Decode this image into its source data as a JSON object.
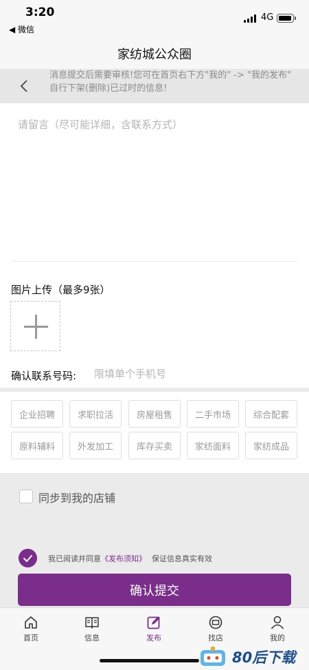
{
  "status": {
    "time": "3:20",
    "back_app": "◀ 微信",
    "network": "4G"
  },
  "nav": {
    "title": "家纺城公众圈"
  },
  "notice": {
    "text": "消息提交后需要审核!您可在首页右下方\"我的\" -> \"我的发布\" 自行下架(删除)已过时的信息!"
  },
  "form": {
    "message_placeholder": "请留言（尽可能详细，含联系方式）",
    "upload_label": "图片上传（最多9张）",
    "phone_label": "确认联系号码:",
    "phone_placeholder": "限填单个手机号"
  },
  "categories": [
    "企业招聘",
    "求职拉活",
    "房屋租售",
    "二手市场",
    "综合配套",
    "原料辅料",
    "外发加工",
    "库存买卖",
    "家纺面料",
    "家纺成品"
  ],
  "sync": {
    "label": "同步到我的店铺"
  },
  "agreement": {
    "prefix": "我已阅读并同意",
    "link": "《发布须知》",
    "suffix": "保证信息真实有效"
  },
  "submit_label": "确认提交",
  "tabs": [
    {
      "label": "首页",
      "icon": "home-icon"
    },
    {
      "label": "信息",
      "icon": "book-icon"
    },
    {
      "label": "发布",
      "icon": "edit-icon",
      "active": true
    },
    {
      "label": "找店",
      "icon": "shop-icon"
    },
    {
      "label": "我的",
      "icon": "user-icon"
    }
  ],
  "watermark": {
    "text": "80后下载"
  },
  "colors": {
    "accent": "#7b2d8b",
    "notice_bg": "#e6e6e6",
    "page_bg": "#ebebeb"
  }
}
